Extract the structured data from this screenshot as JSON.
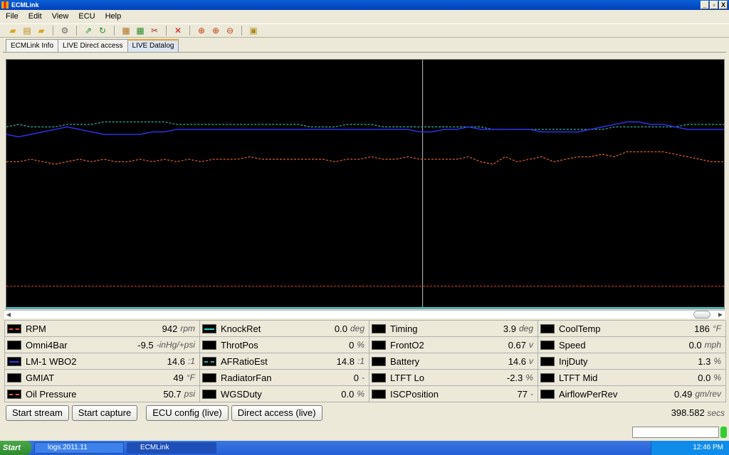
{
  "window": {
    "title": "ECMLink",
    "controls": [
      "_",
      "▫",
      "X"
    ]
  },
  "menu": [
    "File",
    "Edit",
    "View",
    "ECU",
    "Help"
  ],
  "toolbar_icons": [
    "open-folder-icon",
    "save-icon",
    "folder-icon",
    "settings-icon",
    "export-icon",
    "refresh-icon",
    "chart-icon",
    "chart-settings-icon",
    "tools-icon",
    "delete-icon",
    "zoom-fit-icon",
    "zoom-in-icon",
    "zoom-out-icon",
    "report-icon"
  ],
  "tabs": [
    {
      "label": "ECMLink Info",
      "active": false
    },
    {
      "label": "LIVE Direct access",
      "active": false
    },
    {
      "label": "LIVE Datalog",
      "active": true
    }
  ],
  "channels": [
    [
      {
        "name": "RPM",
        "value": "942",
        "unit": "rpm",
        "color": "#e0502a",
        "style": "dashed"
      },
      {
        "name": "Omni4Bar",
        "value": "-9.5",
        "unit": "-inHg/+psi",
        "color": "",
        "style": "none"
      },
      {
        "name": "LM-1 WBO2",
        "value": "14.6",
        "unit": ":1",
        "color": "#3030e8",
        "style": "solid"
      },
      {
        "name": "GMIAT",
        "value": "49",
        "unit": "°F",
        "color": "",
        "style": "none"
      },
      {
        "name": "Oil Pressure",
        "value": "50.7",
        "unit": "psi",
        "color": "#e06030",
        "style": "dashed"
      }
    ],
    [
      {
        "name": "KnockRet",
        "value": "0.0",
        "unit": "deg",
        "color": "#30d0d0",
        "style": "solid"
      },
      {
        "name": "ThrotPos",
        "value": "0",
        "unit": "%",
        "color": "",
        "style": "none"
      },
      {
        "name": "AFRatioEst",
        "value": "14.8",
        "unit": ":1",
        "color": "#30b0a0",
        "style": "dashed"
      },
      {
        "name": "RadiatorFan",
        "value": "0",
        "unit": "-",
        "color": "",
        "style": "none"
      },
      {
        "name": "WGSDuty",
        "value": "0.0",
        "unit": "%",
        "color": "",
        "style": "none"
      }
    ],
    [
      {
        "name": "Timing",
        "value": "3.9",
        "unit": "deg",
        "color": "",
        "style": "none"
      },
      {
        "name": "FrontO2",
        "value": "0.67",
        "unit": "v",
        "color": "",
        "style": "none"
      },
      {
        "name": "Battery",
        "value": "14.6",
        "unit": "v",
        "color": "",
        "style": "none"
      },
      {
        "name": "LTFT Lo",
        "value": "-2.3",
        "unit": "%",
        "color": "",
        "style": "none"
      },
      {
        "name": "ISCPosition",
        "value": "77",
        "unit": "-",
        "color": "",
        "style": "none"
      }
    ],
    [
      {
        "name": "CoolTemp",
        "value": "186",
        "unit": "°F",
        "color": "",
        "style": "none"
      },
      {
        "name": "Speed",
        "value": "0.0",
        "unit": "mph",
        "color": "",
        "style": "none"
      },
      {
        "name": "InjDuty",
        "value": "1.3",
        "unit": "%",
        "color": "",
        "style": "none"
      },
      {
        "name": "LTFT Mid",
        "value": "0.0",
        "unit": "%",
        "color": "",
        "style": "none"
      },
      {
        "name": "AirflowPerRev",
        "value": "0.49",
        "unit": "gm/rev",
        "color": "",
        "style": "none"
      }
    ]
  ],
  "buttons": {
    "start_stream": "Start stream",
    "start_capture": "Start capture",
    "ecu_config": "ECU config (live)",
    "direct_access": "Direct access (live)"
  },
  "elapsed": {
    "value": "398.582",
    "unit": "secs"
  },
  "taskbar": {
    "start": "Start",
    "tasks": [
      {
        "label": "logs.2011.11",
        "active": false
      },
      {
        "label": "ECMLink",
        "active": true
      }
    ],
    "clock": "12:46 PM"
  },
  "graph_traces": {
    "cursor_position": 0.58,
    "afratio_dashed": {
      "color": "#30b0a0",
      "points": [
        0.27,
        0.26,
        0.27,
        0.27,
        0.27,
        0.26,
        0.26,
        0.26,
        0.25,
        0.25,
        0.25,
        0.25,
        0.25,
        0.25,
        0.26,
        0.26,
        0.26,
        0.26,
        0.26,
        0.26,
        0.26,
        0.26,
        0.26,
        0.26,
        0.26,
        0.27,
        0.27,
        0.27,
        0.26,
        0.26,
        0.26,
        0.27,
        0.27,
        0.27,
        0.27,
        0.27,
        0.27,
        0.27,
        0.27,
        0.27,
        0.28,
        0.28,
        0.28,
        0.28,
        0.28,
        0.28,
        0.28,
        0.28,
        0.28,
        0.28,
        0.27,
        0.27,
        0.27,
        0.27,
        0.27,
        0.27,
        0.26,
        0.26,
        0.26,
        0.26
      ]
    },
    "wbo2_solid": {
      "color": "#3030e8",
      "points": [
        0.3,
        0.31,
        0.3,
        0.29,
        0.28,
        0.27,
        0.28,
        0.29,
        0.3,
        0.3,
        0.3,
        0.3,
        0.29,
        0.29,
        0.28,
        0.28,
        0.28,
        0.28,
        0.28,
        0.28,
        0.28,
        0.28,
        0.28,
        0.28,
        0.28,
        0.28,
        0.28,
        0.28,
        0.28,
        0.28,
        0.28,
        0.28,
        0.28,
        0.28,
        0.29,
        0.29,
        0.28,
        0.28,
        0.27,
        0.28,
        0.28,
        0.28,
        0.28,
        0.28,
        0.29,
        0.29,
        0.29,
        0.29,
        0.28,
        0.27,
        0.26,
        0.25,
        0.25,
        0.26,
        0.26,
        0.27,
        0.28,
        0.28,
        0.28,
        0.28
      ]
    },
    "oil_dashed": {
      "color": "#e06030",
      "points": [
        0.41,
        0.41,
        0.4,
        0.41,
        0.42,
        0.41,
        0.4,
        0.41,
        0.4,
        0.41,
        0.41,
        0.4,
        0.41,
        0.4,
        0.41,
        0.4,
        0.41,
        0.4,
        0.4,
        0.4,
        0.39,
        0.4,
        0.4,
        0.4,
        0.4,
        0.4,
        0.4,
        0.41,
        0.4,
        0.4,
        0.39,
        0.4,
        0.4,
        0.39,
        0.4,
        0.4,
        0.4,
        0.4,
        0.39,
        0.41,
        0.42,
        0.39,
        0.41,
        0.4,
        0.39,
        0.41,
        0.4,
        0.39,
        0.39,
        0.38,
        0.39,
        0.37,
        0.37,
        0.37,
        0.37,
        0.38,
        0.39,
        0.4,
        0.41,
        0.41
      ]
    },
    "rpm_dashed": {
      "color": "#c03020",
      "points": [
        0.91,
        0.91,
        0.91,
        0.91,
        0.91,
        0.91,
        0.91,
        0.91,
        0.91,
        0.91,
        0.91,
        0.91,
        0.91,
        0.91,
        0.91,
        0.91,
        0.91,
        0.91,
        0.91,
        0.91,
        0.91,
        0.91,
        0.91,
        0.91,
        0.91,
        0.91,
        0.91,
        0.91,
        0.91,
        0.91,
        0.91,
        0.91,
        0.91,
        0.91,
        0.91,
        0.91,
        0.91,
        0.91,
        0.91,
        0.91,
        0.91,
        0.91,
        0.91,
        0.91,
        0.91,
        0.91,
        0.91,
        0.91,
        0.91,
        0.91,
        0.91,
        0.91,
        0.91,
        0.91,
        0.91,
        0.91,
        0.91,
        0.91,
        0.91,
        0.91
      ]
    }
  }
}
